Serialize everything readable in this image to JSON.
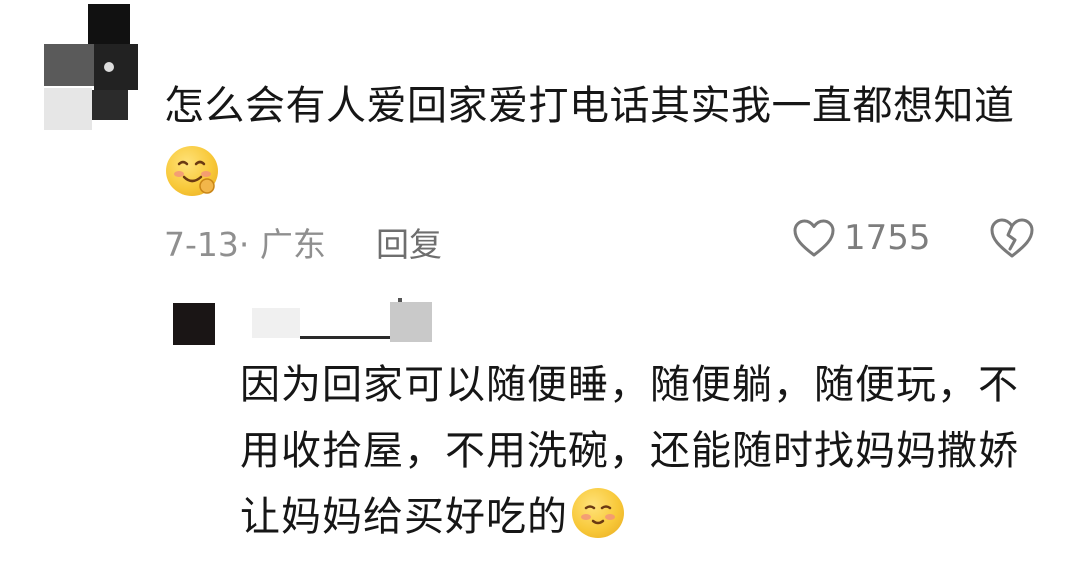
{
  "comment": {
    "avatar_icon": "redacted-avatar",
    "text": "怎么会有人爱回家爱打电话其实我一直都想知道",
    "emoji": "smiling-face-emoji",
    "date_location": "7-13· 广东",
    "reply_label": "回复",
    "like_icon": "heart-outline-icon",
    "like_count": "1755",
    "dislike_icon": "broken-heart-icon"
  },
  "reply": {
    "avatar_icon": "redacted-avatar",
    "username_icon": "redacted-username",
    "lines": [
      "因为回家可以随便睡，随便躺，随便玩，不",
      "用收拾屋，不用洗碗，还能随时找妈妈撒娇",
      "让妈妈给买好吃的"
    ],
    "emoji": "shy-smile-emoji"
  },
  "colors": {
    "text": "#161616",
    "meta": "#8f8f8f",
    "icon": "#7a7a7a",
    "emoji_yellow": "#f8c93a"
  }
}
